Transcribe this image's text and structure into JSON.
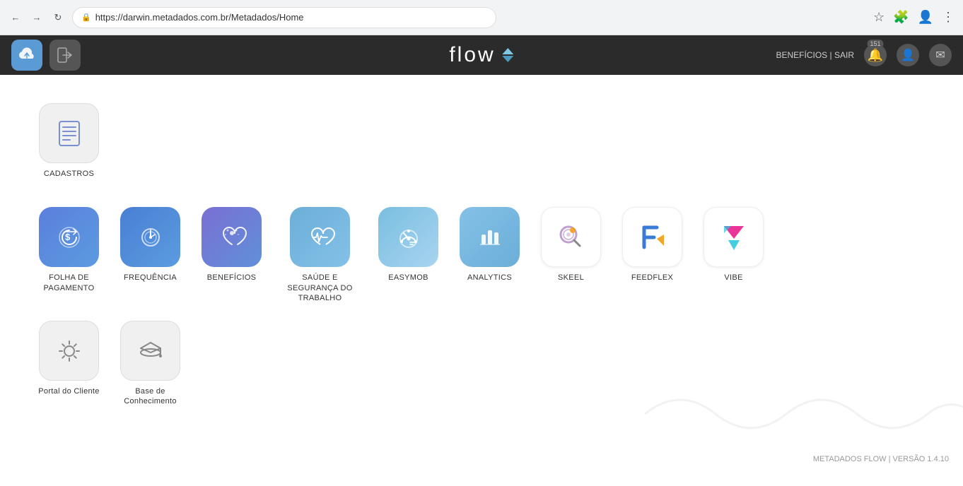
{
  "browser": {
    "url": "https://darwin.metadados.com.br/Metadados/Home",
    "favicon": "🔒"
  },
  "header": {
    "logo": "flow",
    "nav_links": "BENEFÍCIOS | SAIR",
    "beneficios_label": "BENEFÍCIOS",
    "sair_label": "SAIR",
    "notification_count": "151"
  },
  "sections": {
    "row0": {
      "items": [
        {
          "id": "cadastros",
          "label": "CADASTROS",
          "icon_type": "cadastros",
          "icon_color": "gray"
        }
      ]
    },
    "row1": {
      "items": [
        {
          "id": "folha",
          "label": "FOLHA DE PAGAMENTO",
          "icon_type": "folha",
          "icon_color": "blue"
        },
        {
          "id": "frequencia",
          "label": "FREQUÊNCIA",
          "icon_type": "frequencia",
          "icon_color": "blue2"
        },
        {
          "id": "beneficios",
          "label": "BENEFÍCIOS",
          "icon_type": "beneficios",
          "icon_color": "blue3"
        },
        {
          "id": "saude",
          "label": "SAÚDE E SEGURANÇA DO TRABALHO",
          "icon_type": "saude",
          "icon_color": "teal"
        },
        {
          "id": "easymob",
          "label": "EASYMOB",
          "icon_type": "easymob",
          "icon_color": "light-blue"
        },
        {
          "id": "analytics",
          "label": "ANALYTICS",
          "icon_type": "analytics",
          "icon_color": "light-blue2"
        },
        {
          "id": "skeel",
          "label": "SKEEL",
          "icon_type": "skeel",
          "icon_color": "skeel"
        },
        {
          "id": "feedflex",
          "label": "FEEDFLEX",
          "icon_type": "feedflex",
          "icon_color": "feedflex"
        },
        {
          "id": "vibe",
          "label": "VIBE",
          "icon_type": "vibe",
          "icon_color": "vibe"
        }
      ]
    },
    "row2": {
      "items": [
        {
          "id": "portal",
          "label": "Portal do Cliente",
          "icon_type": "portal",
          "icon_color": "gray"
        },
        {
          "id": "base",
          "label": "Base de Conhecimento",
          "icon_type": "base",
          "icon_color": "gray"
        }
      ]
    }
  },
  "footer": {
    "text": "METADADOS FLOW | VERSÃO 1.4.10"
  }
}
